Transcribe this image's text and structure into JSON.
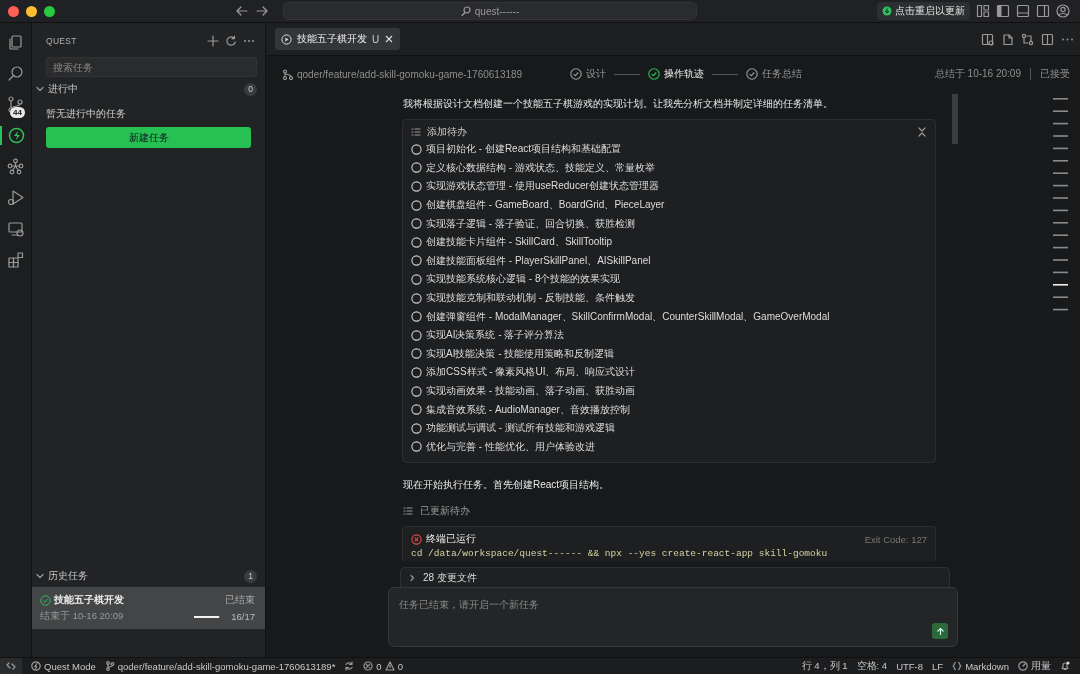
{
  "titlebar": {
    "search": {
      "value": "quest------"
    },
    "update_button": "点击重启以更新"
  },
  "activity_bar": {
    "items": [
      {
        "kind": "files",
        "selected": false
      },
      {
        "kind": "search",
        "selected": false
      },
      {
        "kind": "source-control",
        "selected": false,
        "badge": "44"
      },
      {
        "kind": "quest",
        "selected": true
      },
      {
        "kind": "graph",
        "selected": false
      },
      {
        "kind": "run",
        "selected": false
      },
      {
        "kind": "remote",
        "selected": false
      },
      {
        "kind": "extensions",
        "selected": false
      }
    ]
  },
  "sidebar": {
    "title": "QUEST",
    "search": {
      "placeholder": "搜索任务"
    },
    "sections": [
      {
        "title": "进行中",
        "count": "0",
        "expanded": true,
        "empty_text": "暂无进行中的任务",
        "button": "新建任务"
      },
      {
        "title": "历史任务",
        "count": "1",
        "expanded": true,
        "tasks": [
          {
            "title": "技能五子棋开发",
            "status": "已结束",
            "ended": "结束于 10-16 20:09",
            "level": 0.94,
            "progress": "16/17",
            "selected": true
          }
        ]
      }
    ]
  },
  "tabs": [
    {
      "label": "技能五子棋开发",
      "badge": "U",
      "selected": true
    }
  ],
  "header": {
    "branch": "qoder/feature/add-skill-gomoku-game-1760613189",
    "steps": [
      {
        "label": "设计",
        "selected": false
      },
      {
        "label": "操作轨迹",
        "selected": true
      },
      {
        "label": "任务总结",
        "selected": false
      }
    ],
    "summary_time": "总结于 10-16 20:09",
    "status": "已接受"
  },
  "chat": {
    "intro": "我将根据设计文档创建一个技能五子棋游戏的实现计划。让我先分析文档并制定详细的任务清单。",
    "todo_card": {
      "title": "添加待办",
      "items": [
        {
          "text": "项目初始化 - 创建React项目结构和基础配置",
          "done": false
        },
        {
          "text": "定义核心数据结构 - 游戏状态、技能定义、常量枚举",
          "done": false
        },
        {
          "text": "实现游戏状态管理 - 使用useReducer创建状态管理器",
          "done": false
        },
        {
          "text": "创建棋盘组件 - GameBoard、BoardGrid、PieceLayer",
          "done": false
        },
        {
          "text": "实现落子逻辑 - 落子验证、回合切换、获胜检测",
          "done": false
        },
        {
          "text": "创建技能卡片组件 - SkillCard、SkillTooltip",
          "done": false
        },
        {
          "text": "创建技能面板组件 - PlayerSkillPanel、AISkillPanel",
          "done": false
        },
        {
          "text": "实现技能系统核心逻辑 - 8个技能的效果实现",
          "done": false
        },
        {
          "text": "实现技能克制和联动机制 - 反制技能、条件触发",
          "done": false
        },
        {
          "text": "创建弹窗组件 - ModalManager、SkillConfirmModal、CounterSkillModal、GameOverModal",
          "done": false
        },
        {
          "text": "实现AI决策系统 - 落子评分算法",
          "done": false
        },
        {
          "text": "实现AI技能决策 - 技能使用策略和反制逻辑",
          "done": false
        },
        {
          "text": "添加CSS样式 - 像素风格UI、布局、响应式设计",
          "done": false
        },
        {
          "text": "实现动画效果 - 技能动画、落子动画、获胜动画",
          "done": false
        },
        {
          "text": "集成音效系统 - AudioManager、音效播放控制",
          "done": false
        },
        {
          "text": "功能测试与调试 - 测试所有技能和游戏逻辑",
          "done": false
        },
        {
          "text": "优化与完善 - 性能优化、用户体验改进",
          "done": false
        }
      ]
    },
    "next_text": "现在开始执行任务。首先创建React项目结构。",
    "updated_note": "已更新待办",
    "terminal": {
      "title": "终端已运行",
      "exit_code": "Exit Code: 127",
      "command": "cd /data/workspace/quest------ && npx --yes create-react-app skill-gomoku"
    }
  },
  "changed_files": {
    "label": "28 变更文件",
    "expanded": false
  },
  "composer": {
    "placeholder": "任务已结束，请开启一个新任务"
  },
  "status_bar": {
    "mode": "Quest Mode",
    "branch": "qoder/feature/add-skill-gomoku-game-1760613189*",
    "errors": "0",
    "warnings": "0",
    "right": [
      "行 4，列 1",
      "空格: 4",
      "UTF-8",
      "LF"
    ],
    "language": "Markdown",
    "usage": "用量"
  }
}
